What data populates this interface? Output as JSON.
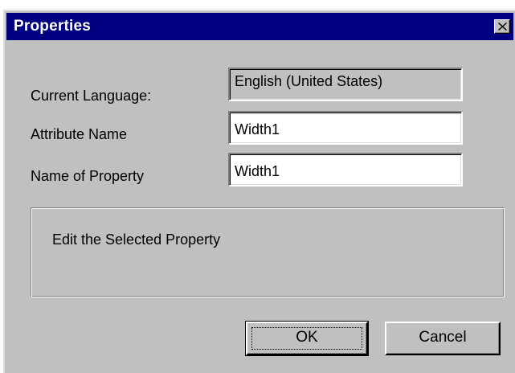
{
  "dialog": {
    "title": "Properties",
    "close_icon": "close-x-icon"
  },
  "fields": {
    "current_language": {
      "label": "Current Language:",
      "value": "English (United States)"
    },
    "attribute_name": {
      "label": "Attribute Name",
      "value": "Width1"
    },
    "name_of_property": {
      "label": "Name of Property",
      "value": "Width1"
    }
  },
  "group": {
    "text": "Edit the Selected Property"
  },
  "buttons": {
    "ok_label": "OK",
    "cancel_label": "Cancel"
  },
  "colors": {
    "titlebar": "#000080",
    "face": "#c0c0c0"
  }
}
